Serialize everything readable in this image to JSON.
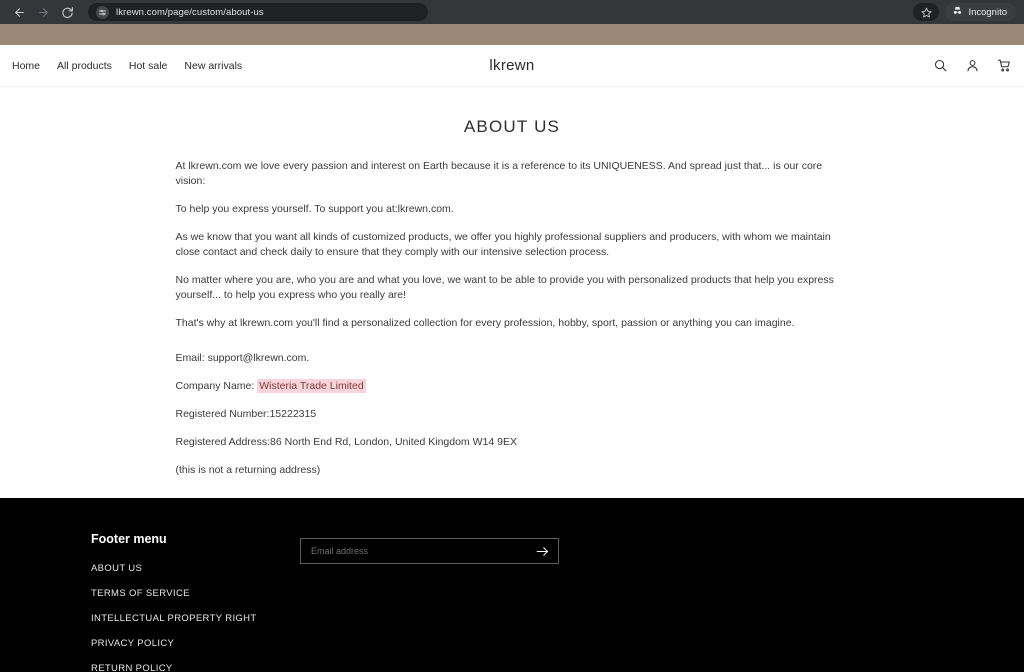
{
  "browser": {
    "back_icon": "arrow-left-icon",
    "forward_icon": "arrow-right-icon",
    "reload_icon": "reload-icon",
    "tune_icon": "tune-icon",
    "url": "lkrewn.com/page/custom/about-us",
    "bookmark_icon": "star-icon",
    "incognito_label": "Incognito",
    "incognito_icon": "incognito-icon"
  },
  "header": {
    "brand": "lkrewn",
    "nav": [
      {
        "label": "Home"
      },
      {
        "label": "All products"
      },
      {
        "label": "Hot sale"
      },
      {
        "label": "New arrivals"
      }
    ],
    "icons": [
      {
        "name": "search-icon"
      },
      {
        "name": "account-icon"
      },
      {
        "name": "cart-icon"
      }
    ]
  },
  "main": {
    "title": "ABOUT US",
    "paragraphs": [
      "At lkrewn.com we love every passion and interest on Earth because it is a reference to its UNIQUENESS. And spread just that... is our core vision:",
      "To help you express yourself. To support you at:lkrewn.com.",
      "As we know that you want all kinds of customized products, we offer you highly professional suppliers and producers, with whom we maintain close contact and check daily to ensure that they comply with our intensive selection process.",
      "No matter where you are, who you are and what you love, we want to be able to provide you with personalized products that help you express yourself... to help you express who you really are!",
      "That's why at lkrewn.com you'll find a personalized collection for every profession, hobby, sport, passion or anything you can imagine."
    ],
    "details": {
      "email_line": "Email: support@lkrewn.com.",
      "company_label": "Company Name:",
      "company_name": "Wisteria Trade Limited",
      "registered_number": "Registered Number:15222315",
      "registered_address": "Registered Address:86 North End Rd, London, United Kingdom W14 9EX",
      "note": "(this is not a returning address)"
    }
  },
  "footer": {
    "menu_title": "Footer menu",
    "links": [
      {
        "label": "ABOUT US"
      },
      {
        "label": "TERMS OF SERVICE"
      },
      {
        "label": "INTELLECTUAL PROPERTY RIGHT"
      },
      {
        "label": "PRIVACY POLICY"
      },
      {
        "label": "RETURN POLICY"
      }
    ],
    "newsletter": {
      "placeholder": "Email address",
      "value": "",
      "submit_icon": "arrow-right-icon"
    }
  },
  "colors": {
    "accent_band": "#9b8877",
    "footer_bg": "#000000",
    "highlight_bg": "#f7d4d7",
    "highlight_text": "#7d3b3f"
  }
}
